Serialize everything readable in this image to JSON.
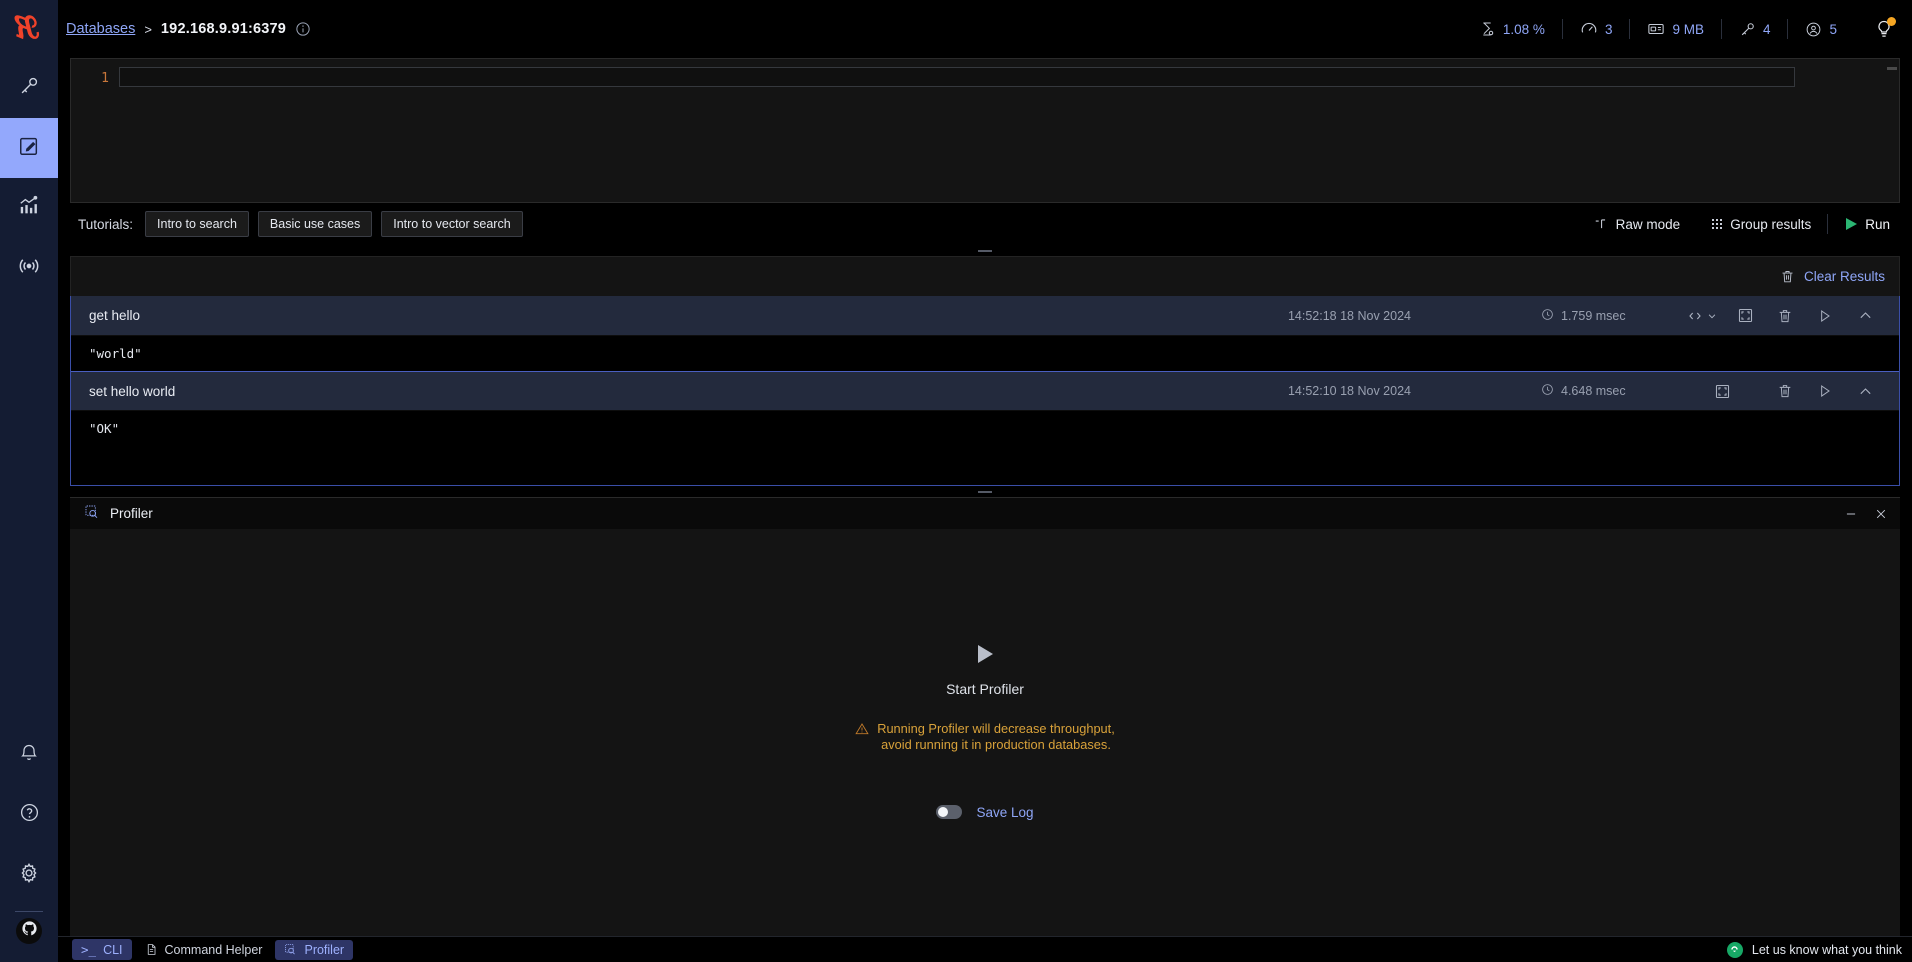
{
  "app": {
    "logo": "redis-insight-logo"
  },
  "sidebar": {
    "items": [
      {
        "name": "browser",
        "icon": "key-icon"
      },
      {
        "name": "workbench",
        "icon": "edit-square-icon",
        "active": true
      },
      {
        "name": "analytics",
        "icon": "bar-chart-icon"
      },
      {
        "name": "pubsub",
        "icon": "broadcast-icon"
      }
    ],
    "bottom": [
      {
        "name": "notifications",
        "icon": "bell-icon"
      },
      {
        "name": "help",
        "icon": "question-circle-icon"
      },
      {
        "name": "settings",
        "icon": "gear-icon"
      },
      {
        "name": "github",
        "icon": "github-icon"
      }
    ]
  },
  "header": {
    "breadcrumb_root": "Databases",
    "breadcrumb_separator": ">",
    "database": "192.168.9.91:6379",
    "info_icon": "info-circle-icon",
    "metrics": [
      {
        "icon": "cpu-icon",
        "value": "1.08 %"
      },
      {
        "icon": "speedometer-icon",
        "value": "3"
      },
      {
        "icon": "memory-icon",
        "value": "9 MB"
      },
      {
        "icon": "key-icon",
        "value": "4"
      },
      {
        "icon": "user-icon",
        "value": "5"
      }
    ],
    "bulb_icon": "lightbulb-icon"
  },
  "workbench": {
    "line_number": "1",
    "editor_value": "",
    "tutorials_label": "Tutorials:",
    "tutorials": [
      "Intro to search",
      "Basic use cases",
      "Intro to vector search"
    ],
    "raw_mode": "Raw mode",
    "group_results": "Group results",
    "run": "Run"
  },
  "results": {
    "clear_label": "Clear Results",
    "rows": [
      {
        "command": "get hello",
        "time": "14:52:18 18 Nov 2024",
        "duration": "1.759 msec",
        "output": "\"world\"",
        "has_code_toggle": true
      },
      {
        "command": "set hello world",
        "time": "14:52:10 18 Nov 2024",
        "duration": "4.648 msec",
        "output": "\"OK\"",
        "has_code_toggle": false
      }
    ]
  },
  "profiler": {
    "title": "Profiler",
    "icon": "profiler-icon",
    "start_label": "Start Profiler",
    "warning_line1": "Running Profiler will decrease throughput,",
    "warning_line2": "avoid running it in production databases.",
    "save_log_label": "Save Log",
    "save_log_on": false,
    "minimize_icon": "minimize-icon",
    "close_icon": "close-icon"
  },
  "statusbar": {
    "tabs": [
      {
        "label": "CLI",
        "icon": "terminal-icon",
        "highlight": true
      },
      {
        "label": "Command Helper",
        "icon": "document-icon",
        "highlight": false
      },
      {
        "label": "Profiler",
        "icon": "profiler-icon",
        "highlight": true
      }
    ],
    "feedback": "Let us know what you think"
  },
  "colors": {
    "accent_blue": "#8fa6f7",
    "brand_red": "#f0422a",
    "run_green": "#2bb673",
    "warning": "#d9a23a",
    "sidebar_bg": "#141c33",
    "row_bg": "#232a3d"
  }
}
